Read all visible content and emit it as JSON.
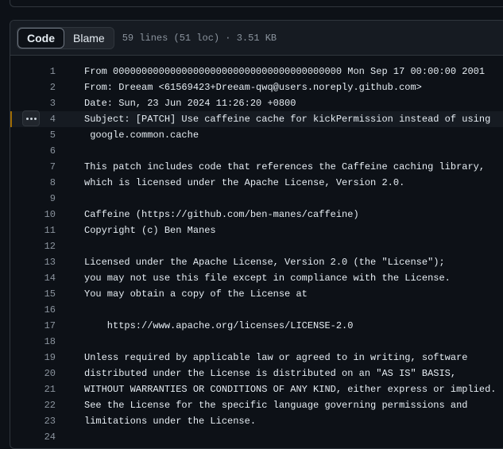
{
  "tabs": {
    "code_label": "Code",
    "blame_label": "Blame"
  },
  "file_meta": "59 lines (51 loc) · 3.51 KB",
  "icons": {
    "line_menu": "kebab-horizontal-icon"
  },
  "colors": {
    "background": "#0d1117",
    "highlight_marker": "#9e6a03"
  },
  "highlighted_line": "4",
  "lines": [
    {
      "number": "1",
      "text": "From 0000000000000000000000000000000000000000 Mon Sep 17 00:00:00 2001"
    },
    {
      "number": "2",
      "text": "From: Dreeam <61569423+Dreeam-qwq@users.noreply.github.com>"
    },
    {
      "number": "3",
      "text": "Date: Sun, 23 Jun 2024 11:26:20 +0800"
    },
    {
      "number": "4",
      "text": "Subject: [PATCH] Use caffeine cache for kickPermission instead of using"
    },
    {
      "number": "5",
      "text": " google.common.cache"
    },
    {
      "number": "6",
      "text": ""
    },
    {
      "number": "7",
      "text": "This patch includes code that references the Caffeine caching library,"
    },
    {
      "number": "8",
      "text": "which is licensed under the Apache License, Version 2.0."
    },
    {
      "number": "9",
      "text": ""
    },
    {
      "number": "10",
      "text": "Caffeine (https://github.com/ben-manes/caffeine)"
    },
    {
      "number": "11",
      "text": "Copyright (c) Ben Manes"
    },
    {
      "number": "12",
      "text": ""
    },
    {
      "number": "13",
      "text": "Licensed under the Apache License, Version 2.0 (the \"License\");"
    },
    {
      "number": "14",
      "text": "you may not use this file except in compliance with the License."
    },
    {
      "number": "15",
      "text": "You may obtain a copy of the License at"
    },
    {
      "number": "16",
      "text": ""
    },
    {
      "number": "17",
      "text": "    https://www.apache.org/licenses/LICENSE-2.0"
    },
    {
      "number": "18",
      "text": ""
    },
    {
      "number": "19",
      "text": "Unless required by applicable law or agreed to in writing, software"
    },
    {
      "number": "20",
      "text": "distributed under the License is distributed on an \"AS IS\" BASIS,"
    },
    {
      "number": "21",
      "text": "WITHOUT WARRANTIES OR CONDITIONS OF ANY KIND, either express or implied."
    },
    {
      "number": "22",
      "text": "See the License for the specific language governing permissions and"
    },
    {
      "number": "23",
      "text": "limitations under the License."
    },
    {
      "number": "24",
      "text": ""
    }
  ]
}
